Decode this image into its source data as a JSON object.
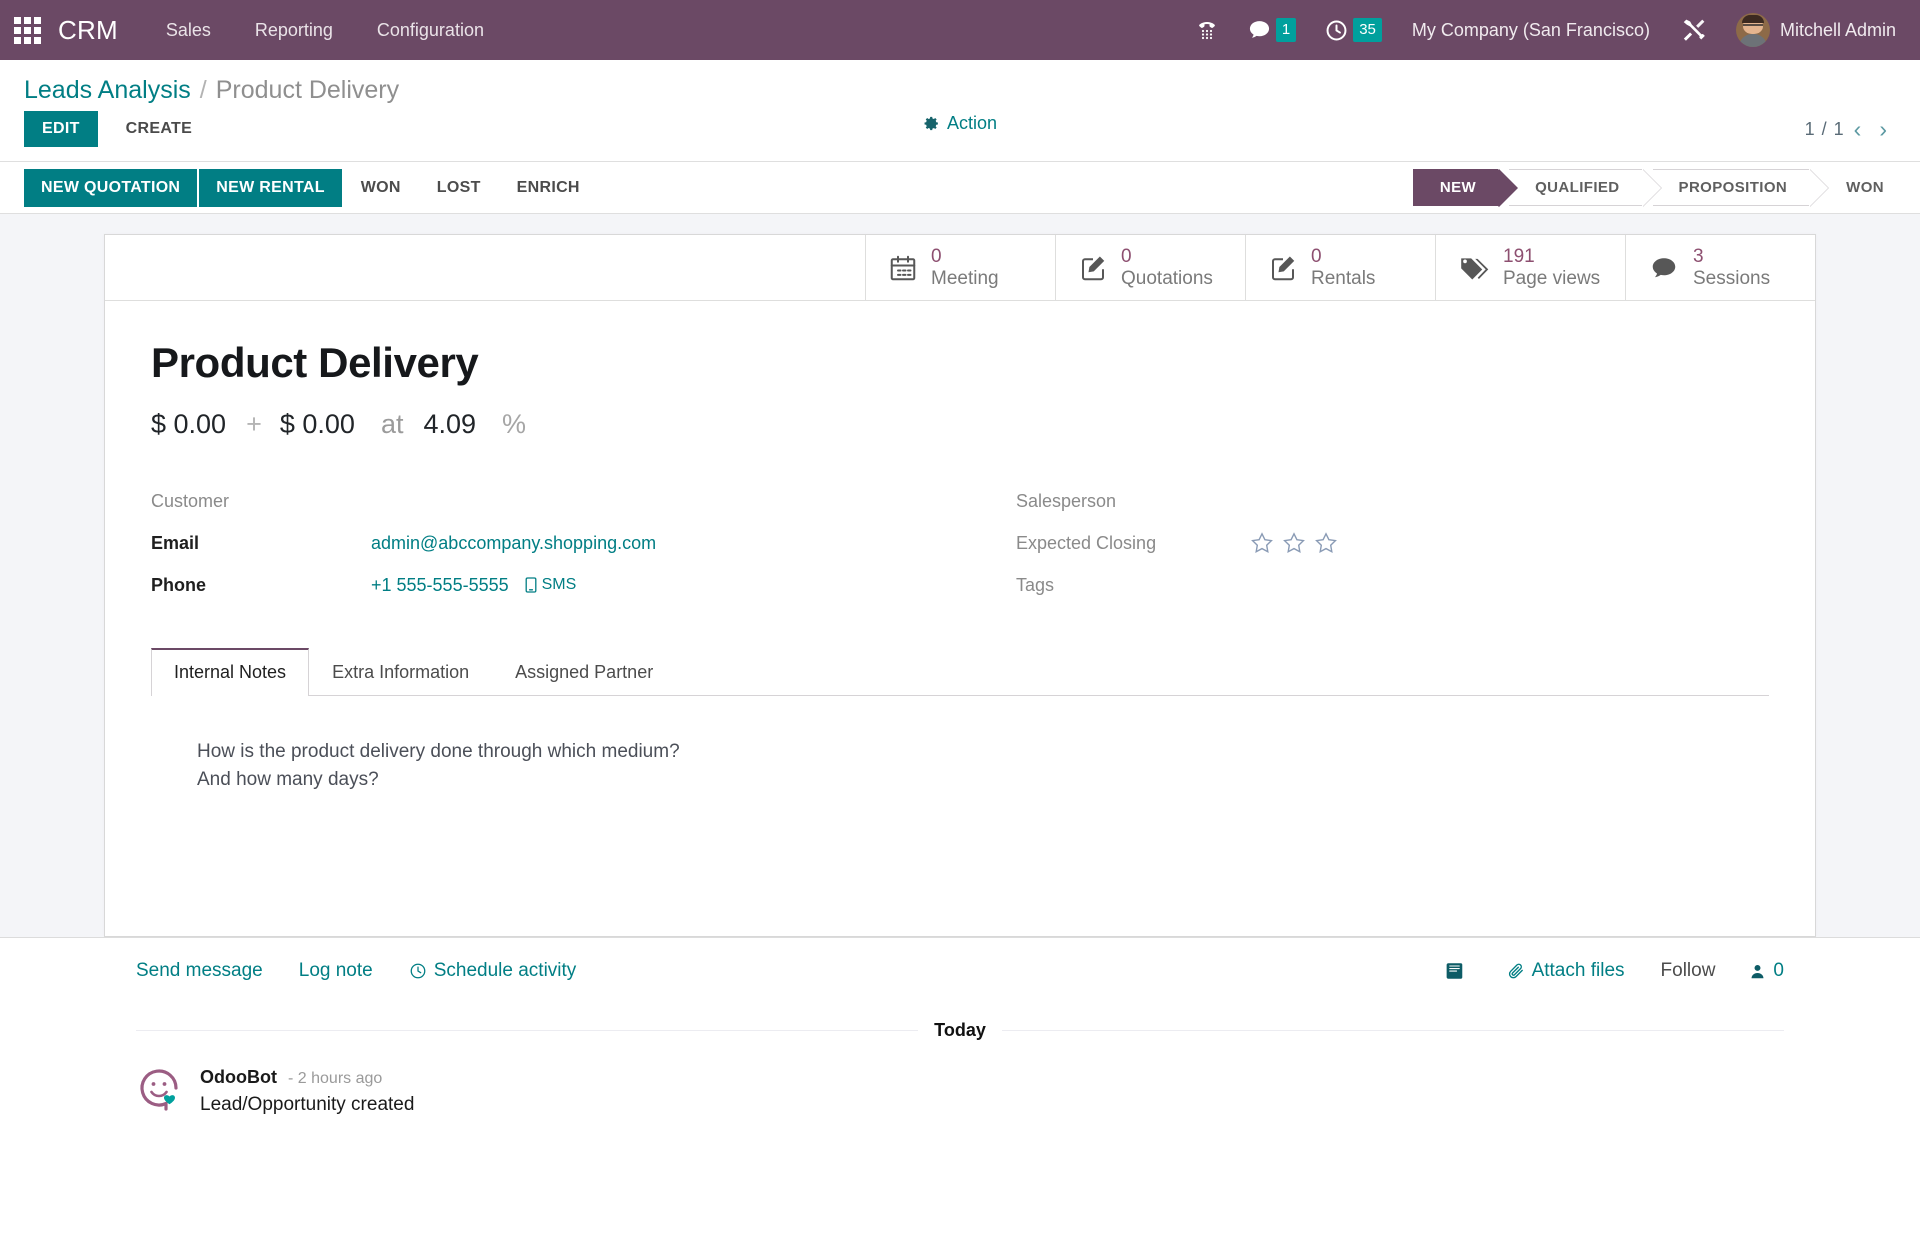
{
  "navbar": {
    "brand": "CRM",
    "apps_icon": "apps-grid-icon",
    "menu": [
      {
        "label": "Sales"
      },
      {
        "label": "Reporting"
      },
      {
        "label": "Configuration"
      }
    ],
    "icons": {
      "phone": "phone-dialpad-icon",
      "messages": "chat-bubble-icon",
      "activities": "clock-icon",
      "settings": "tools-icon"
    },
    "messages_count": "1",
    "activities_count": "35",
    "company": "My Company (San Francisco)",
    "user": "Mitchell Admin"
  },
  "control_panel": {
    "breadcrumb_parent": "Leads Analysis",
    "breadcrumb_sep": "/",
    "breadcrumb_current": "Product Delivery",
    "edit_label": "EDIT",
    "create_label": "CREATE",
    "action_label": "Action",
    "pager_value": "1 / 1",
    "pager_prev": "‹",
    "pager_next": "›"
  },
  "statusbar": {
    "buttons": [
      {
        "label": "NEW QUOTATION",
        "style": "primary"
      },
      {
        "label": "NEW RENTAL",
        "style": "primary"
      },
      {
        "label": "WON",
        "style": "plain"
      },
      {
        "label": "LOST",
        "style": "plain"
      },
      {
        "label": "ENRICH",
        "style": "plain"
      }
    ],
    "stages": [
      {
        "label": "NEW",
        "active": true
      },
      {
        "label": "QUALIFIED",
        "active": false
      },
      {
        "label": "PROPOSITION",
        "active": false
      },
      {
        "label": "WON",
        "active": false
      }
    ]
  },
  "stat_buttons": [
    {
      "icon": "calendar-icon",
      "value": "0",
      "label": "Meeting"
    },
    {
      "icon": "quotation-pencil-icon",
      "value": "0",
      "label": "Quotations"
    },
    {
      "icon": "rental-pencil-icon",
      "value": "0",
      "label": "Rentals"
    },
    {
      "icon": "tags-icon",
      "value": "191",
      "label": "Page views"
    },
    {
      "icon": "speech-bubble-icon",
      "value": "3",
      "label": "Sessions"
    }
  ],
  "record": {
    "title": "Product Delivery",
    "expected_revenue": "$ 0.00",
    "plus": "+",
    "recurring_revenue": "$ 0.00",
    "at": "at",
    "probability": "4.09",
    "percent": "%",
    "fields_left": [
      {
        "label": "Customer",
        "value": "",
        "muted": true
      },
      {
        "label": "Email",
        "value": "admin@abccompany.shopping.com",
        "link": true
      },
      {
        "label": "Phone",
        "value": "+1 555-555-5555",
        "link": true,
        "sms": "SMS"
      }
    ],
    "fields_right": [
      {
        "label": "Salesperson",
        "value": ""
      },
      {
        "label": "Expected Closing",
        "value": ""
      },
      {
        "label": "Tags",
        "value": ""
      }
    ],
    "priority_stars": 3,
    "priority_filled": 0
  },
  "notebook": {
    "tabs": [
      {
        "label": "Internal Notes",
        "active": true
      },
      {
        "label": "Extra Information",
        "active": false
      },
      {
        "label": "Assigned Partner",
        "active": false
      }
    ],
    "note_line_1": "How is the product delivery done through which medium?",
    "note_line_2": "And how many days?"
  },
  "chatter": {
    "send_message": "Send message",
    "log_note": "Log note",
    "schedule_activity": "Schedule activity",
    "attach_files": "Attach files",
    "follow": "Follow",
    "followers_count": "0",
    "log_book_icon": "log-book-icon",
    "today": "Today",
    "message": {
      "author": "OdooBot",
      "date": "- 2 hours ago",
      "body": "Lead/Opportunity created"
    }
  },
  "colors": {
    "brand_purple": "#6b4965",
    "accent_teal": "#017e84",
    "badge_teal": "#00a09d",
    "stat_value": "#8d4f70",
    "sheet_bg": "#f4f5f8"
  }
}
